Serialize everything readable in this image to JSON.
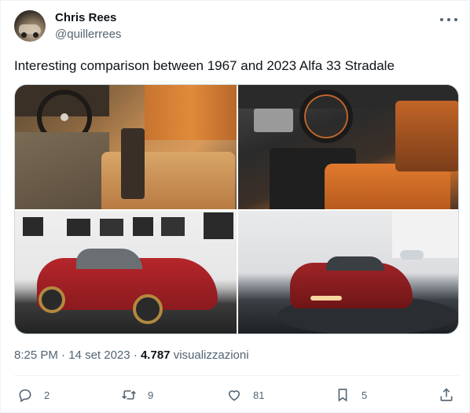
{
  "author": {
    "name": "Chris Rees",
    "handle": "@quillerrees"
  },
  "tweet": {
    "text": "Interesting comparison between 1967 and 2023 Alfa 33 Stradale"
  },
  "media": [
    {
      "name": "photo-1967-interior"
    },
    {
      "name": "photo-2023-interior"
    },
    {
      "name": "photo-1967-exterior"
    },
    {
      "name": "photo-2023-exterior"
    }
  ],
  "meta": {
    "time": "8:25 PM",
    "separator1": "·",
    "date": "14 set 2023",
    "separator2": "·",
    "views_count": "4.787",
    "views_label": "visualizzazioni"
  },
  "actions": {
    "replies": "2",
    "retweets": "9",
    "likes": "81",
    "bookmarks": "5"
  },
  "icons": {
    "more": "more-icon",
    "reply": "reply-icon",
    "retweet": "retweet-icon",
    "like": "heart-icon",
    "bookmark": "bookmark-icon",
    "share": "share-icon"
  },
  "colors": {
    "text": "#0f1419",
    "secondary": "#536471",
    "border": "#eff3f4"
  }
}
